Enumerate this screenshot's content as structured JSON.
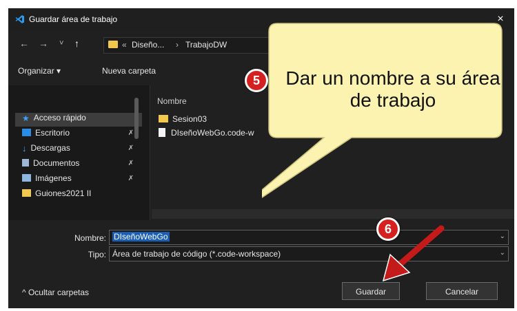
{
  "window": {
    "title": "Guardar área de trabajo",
    "close_glyph": "×"
  },
  "nav": {
    "back_glyph": "←",
    "forward_glyph": "→",
    "recent_glyph": "˅",
    "up_glyph": "↑",
    "overflow_glyph": "«",
    "separator_glyph": "›",
    "path": [
      "Diseño...",
      "TrabajoDW"
    ]
  },
  "toolbar": {
    "organize_label": "Organizar ▾",
    "new_folder_label": "Nueva carpeta"
  },
  "sidebar": {
    "items": [
      {
        "label": "Acceso rápido",
        "icon": "star-icon"
      },
      {
        "label": "Escritorio",
        "icon": "desktop-icon"
      },
      {
        "label": "Descargas",
        "icon": "download-icon"
      },
      {
        "label": "Documentos",
        "icon": "document-icon"
      },
      {
        "label": "Imágenes",
        "icon": "image-icon"
      },
      {
        "label": "Guiones2021 II",
        "icon": "folder-icon"
      }
    ],
    "pin_glyph": "✗"
  },
  "files": {
    "column_header": "Nombre",
    "items": [
      {
        "name": "Sesion03",
        "icon": "folder-icon"
      },
      {
        "name": "DIseñoWebGo.code-w",
        "icon": "file-icon"
      }
    ]
  },
  "form": {
    "name_label": "Nombre:",
    "name_value": "DIseñoWebGo",
    "type_label": "Tipo:",
    "type_value": "Área de trabajo de código (*.code-workspace)"
  },
  "footer": {
    "hide_folders_label": "^  Ocultar carpetas",
    "save_label": "Guardar",
    "cancel_label": "Cancelar"
  },
  "annotation": {
    "callout_text": "Dar un nombre a su área de trabajo",
    "step_five": "5",
    "step_six": "6",
    "badge_color": "#d62020",
    "callout_color": "#fdf3b0"
  }
}
